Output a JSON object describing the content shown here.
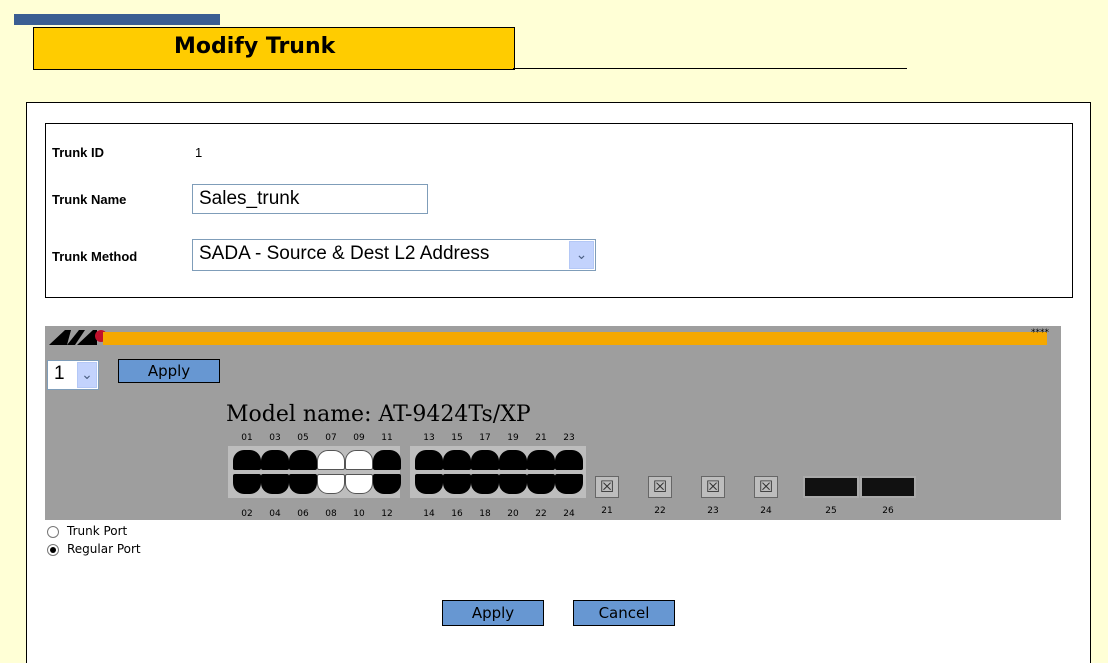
{
  "page": {
    "title": "Modify Trunk"
  },
  "form": {
    "trunk_id_label": "Trunk ID",
    "trunk_id_value": "1",
    "trunk_name_label": "Trunk Name",
    "trunk_name_value": "Sales_trunk",
    "trunk_method_label": "Trunk Method",
    "trunk_method_value": "SADA - Source & Dest L2 Address"
  },
  "device": {
    "stars": "****",
    "unit_value": "1",
    "apply_label": "Apply",
    "model_name": "Model name: AT-9424Ts/XP",
    "top_ports": [
      "01",
      "03",
      "05",
      "07",
      "09",
      "11",
      "13",
      "15",
      "17",
      "19",
      "21",
      "23"
    ],
    "bottom_ports": [
      "02",
      "04",
      "06",
      "08",
      "10",
      "12",
      "14",
      "16",
      "18",
      "20",
      "22",
      "24"
    ],
    "sfp_ports": [
      "21",
      "22",
      "23",
      "24"
    ],
    "xfp_ports": [
      "25",
      "26"
    ],
    "selected_ports": [
      "07",
      "08",
      "09",
      "10"
    ]
  },
  "legend": {
    "trunk_port": "Trunk Port",
    "regular_port": "Regular Port",
    "selected": "regular_port"
  },
  "actions": {
    "apply_label": "Apply",
    "cancel_label": "Cancel"
  },
  "colors": {
    "page_bg": "#FFFFD6",
    "title_bg": "#FFCC00",
    "title_bar": "#3B5E92",
    "button_bg": "#6797D2",
    "device_bg": "#9E9E9E",
    "device_bar": "#F5A800"
  }
}
